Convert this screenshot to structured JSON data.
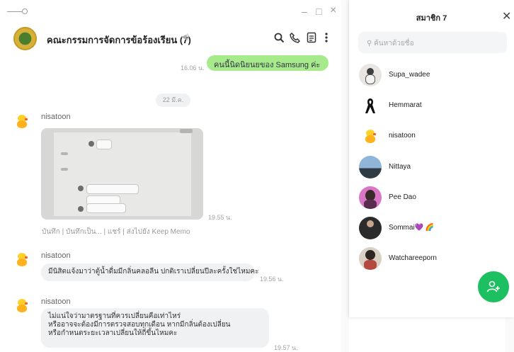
{
  "window": {
    "minimize": "–",
    "maximize": "□",
    "close": "×"
  },
  "chat": {
    "title": "คณะกรรมการจัดการข้อร้องเรียน (7)",
    "mute_icon": "speaker-muted-icon",
    "actions": {
      "search": "search-icon",
      "call": "phone-icon",
      "notes": "notes-icon",
      "menu": "more-icon"
    }
  },
  "messages": {
    "top_bubble": "คนนี้นิดนิยนยของ Samsung ค่ะ",
    "top_time": "16.06 น.",
    "date_divider": "22 มี.ค.",
    "m1": {
      "sender": "nisatoon",
      "time": "19.55 น.",
      "actions": "บันทึก | บันทึกเป็น... | แชร์ | ส่งไปยัง Keep Memo"
    },
    "m2": {
      "sender": "nisatoon",
      "text": "มีนิสิตแจ้งมาว่าตู้น้ำดื่มมีกลิ่นคลอลีน  ปกติเราเปลี่ยนปีละครั้งใช่ไหมคะ",
      "time": "19.56 น."
    },
    "m3": {
      "sender": "nisatoon",
      "lines": [
        "ไม่แน่ใจว่ามาตรฐานที่ควรเปลี่ยนคือเท่าไหร่",
        "หรืออาจจะต้องมีการตรวจสอบทุกเดือน หากมีกลิ่นต้องเปลี่ยน",
        "หรือกำหนดระยะเวลาเปลี่ยนให้ถี่ขึ้นไหมคะ"
      ],
      "time": "19.57 น."
    }
  },
  "members": {
    "title": "สมาชิก 7",
    "search_placeholder": "ค้นหาด้วยชื่อ",
    "list": [
      {
        "name": "Supa_wadee"
      },
      {
        "name": "Hemmarat"
      },
      {
        "name": "nisatoon"
      },
      {
        "name": "Nittaya"
      },
      {
        "name": "Pee Dao"
      },
      {
        "name": "Sommai💜 🌈"
      },
      {
        "name": "Watchareeporn"
      }
    ],
    "add_icon": "add-member-icon"
  },
  "colors": {
    "accent_green": "#1dc060",
    "my_bubble": "#a6ea8c",
    "bubble_grey": "#f0f1f3"
  }
}
